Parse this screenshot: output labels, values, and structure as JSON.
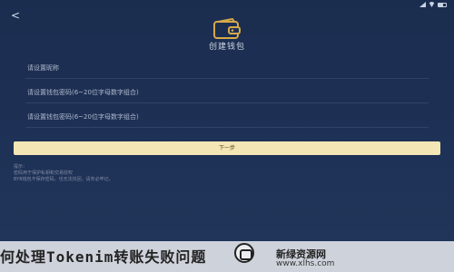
{
  "header": {
    "title": "创建钱包"
  },
  "form": {
    "name_placeholder": "请设置昵称",
    "password_placeholder": "请设置钱包密码(6~20位字母数字组合)",
    "confirm_placeholder": "请设置钱包密码(6~20位字母数字组合)"
  },
  "actions": {
    "next_label": "下一步"
  },
  "hints": {
    "title": "提示：",
    "line1": "密码用于保护私钥和交易授权",
    "line2": "BYB钱包不保存密码，也无法找回，请务必牢记。"
  },
  "watermark": {
    "title": "何处理Tokenim转账失败问题",
    "brand": "新绿资源网",
    "url": "www.xlhs.com"
  },
  "icons": {
    "back": "back-arrow-icon",
    "wallet": "wallet-icon"
  },
  "colors": {
    "background": "#1d2f52",
    "button": "#f5e6b5",
    "divider": "#2f4369"
  }
}
